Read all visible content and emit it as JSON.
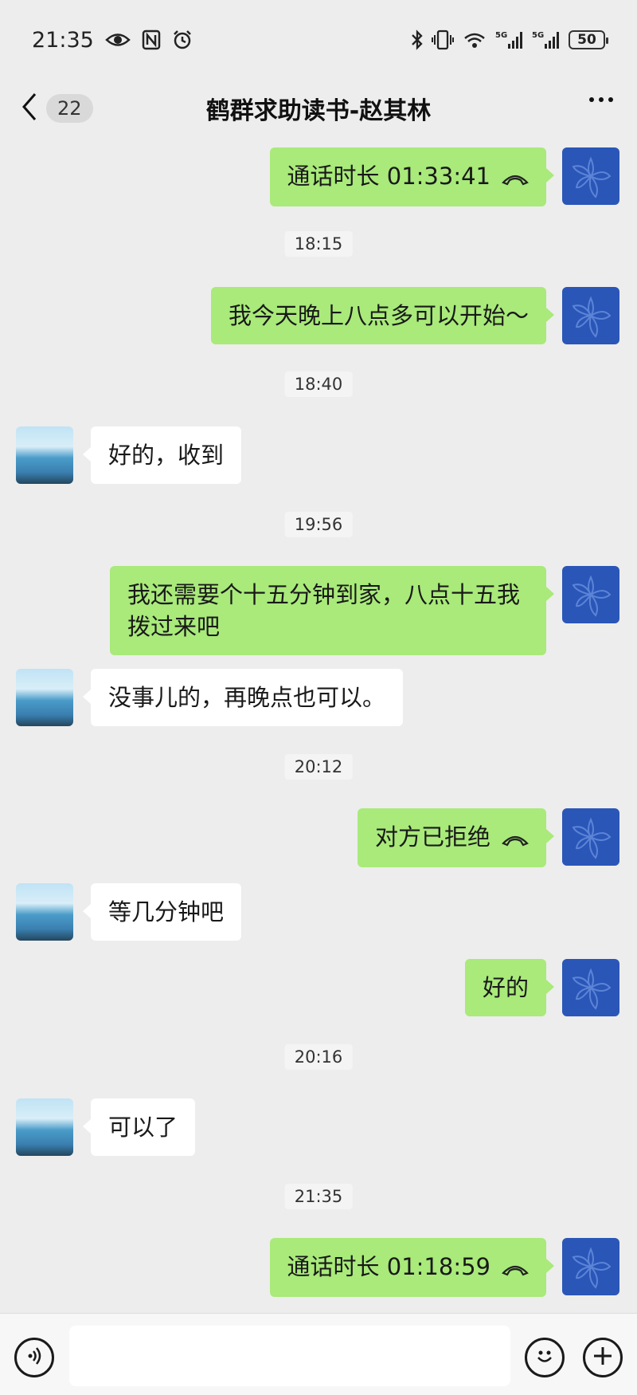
{
  "status_bar": {
    "time": "21:35",
    "battery": "50",
    "left_icons": [
      "eye-icon",
      "nfc-icon",
      "alarm-icon"
    ],
    "right_icons": [
      "bluetooth-icon",
      "vibrate-icon",
      "wifi-icon",
      "signal-5g-icon",
      "signal-5g-icon"
    ]
  },
  "nav": {
    "unread_count": "22",
    "title": "鹤群求助读书-赵其林"
  },
  "messages": [
    {
      "type": "call",
      "side": "self",
      "text": "通话时长 01:33:41"
    },
    {
      "type": "time",
      "text": "18:15"
    },
    {
      "type": "text",
      "side": "self",
      "text": "我今天晚上八点多可以开始～"
    },
    {
      "type": "time",
      "text": "18:40"
    },
    {
      "type": "text",
      "side": "peer",
      "text": "好的，收到"
    },
    {
      "type": "time",
      "text": "19:56"
    },
    {
      "type": "text",
      "side": "self",
      "text": "我还需要个十五分钟到家，八点十五我拨过来吧"
    },
    {
      "type": "text",
      "side": "peer",
      "text": "没事儿的，再晚点也可以。"
    },
    {
      "type": "time",
      "text": "20:12"
    },
    {
      "type": "call",
      "side": "self",
      "text": "对方已拒绝"
    },
    {
      "type": "text",
      "side": "peer",
      "text": "等几分钟吧"
    },
    {
      "type": "text",
      "side": "self",
      "text": "好的"
    },
    {
      "type": "time",
      "text": "20:16"
    },
    {
      "type": "text",
      "side": "peer",
      "text": "可以了"
    },
    {
      "type": "time",
      "text": "21:35"
    },
    {
      "type": "call",
      "side": "self",
      "text": "通话时长 01:18:59"
    }
  ],
  "input_bar": {
    "icons": [
      "voice-icon",
      "emoji-icon",
      "plus-icon"
    ],
    "placeholder": ""
  },
  "colors": {
    "self_bubble": "#a9ea7a",
    "peer_bubble": "#ffffff",
    "background": "#ededed",
    "self_avatar": "#2a56b8"
  }
}
